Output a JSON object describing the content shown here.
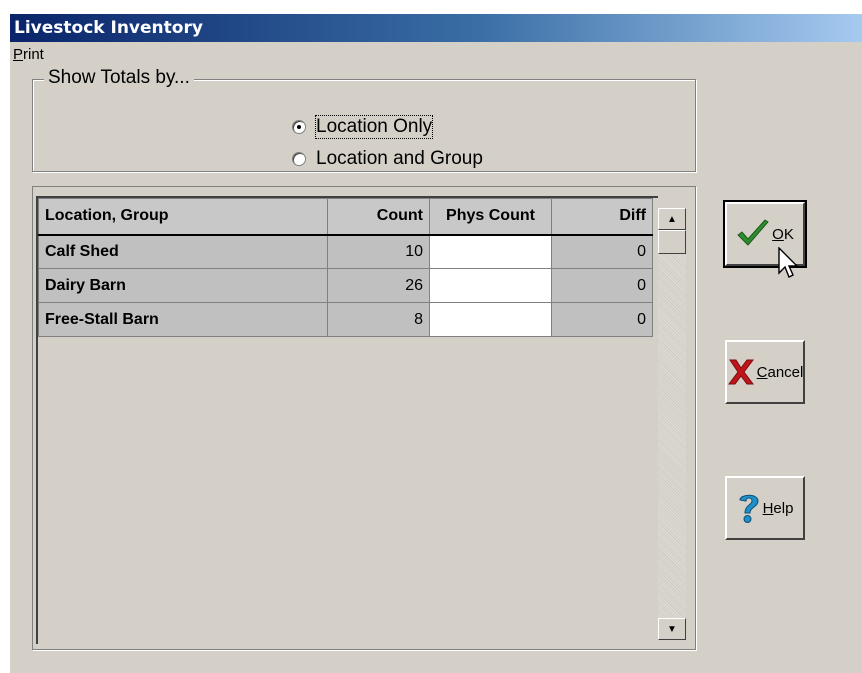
{
  "window": {
    "title": "Livestock Inventory"
  },
  "menu": {
    "items": [
      {
        "mnemonic": "P",
        "rest": "rint"
      }
    ]
  },
  "show_totals": {
    "legend": "Show Totals by...",
    "options": [
      {
        "label": "Location Only",
        "checked": true
      },
      {
        "label": "Location and Group",
        "checked": false
      }
    ]
  },
  "grid": {
    "columns": [
      "Location, Group",
      "Count",
      "Phys Count",
      "Diff"
    ],
    "rows": [
      {
        "location": "Calf Shed",
        "count": "10",
        "phys_count": "",
        "diff": "0"
      },
      {
        "location": "Dairy Barn",
        "count": "26",
        "phys_count": "",
        "diff": "0"
      },
      {
        "location": "Free-Stall Barn",
        "count": "8",
        "phys_count": "",
        "diff": "0"
      }
    ]
  },
  "buttons": {
    "ok": {
      "mnemonic": "O",
      "rest": "K",
      "icon": "checkmark-icon",
      "color": "#2e8b2e"
    },
    "cancel": {
      "mnemonic": "C",
      "rest": "ancel",
      "icon": "red-x-icon",
      "color": "#c0141a"
    },
    "help": {
      "mnemonic": "H",
      "rest": "elp",
      "icon": "question-mark-icon",
      "color": "#1e8fc8"
    }
  }
}
